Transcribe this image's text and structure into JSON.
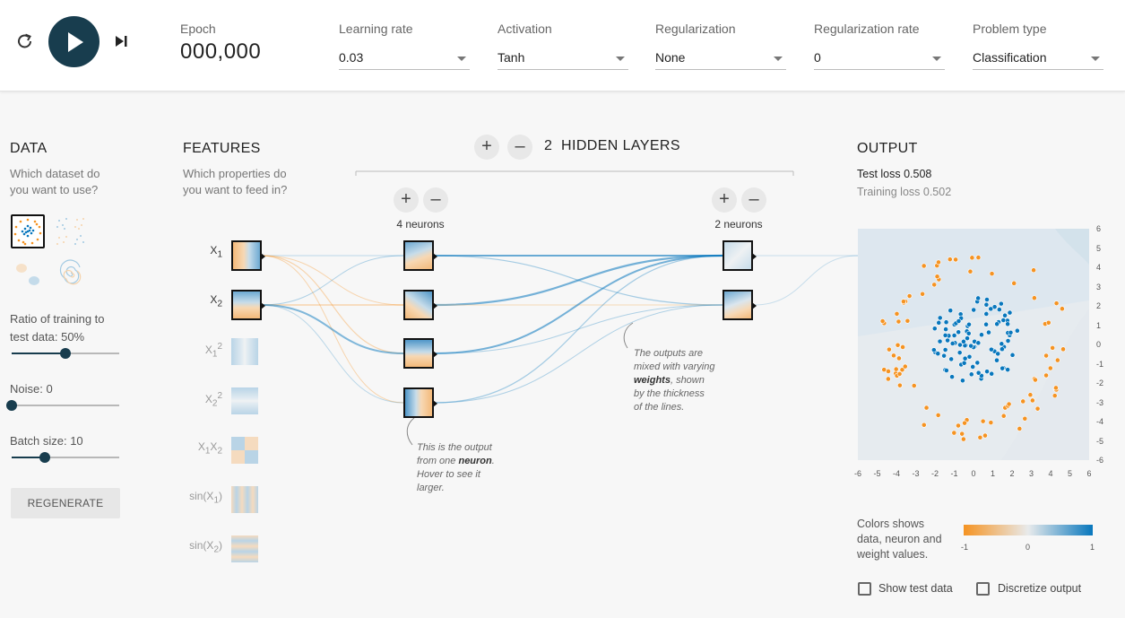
{
  "header": {
    "epoch_label": "Epoch",
    "epoch_value": "000,000",
    "controls": [
      {
        "label": "Learning rate",
        "value": "0.03"
      },
      {
        "label": "Activation",
        "value": "Tanh"
      },
      {
        "label": "Regularization",
        "value": "None"
      },
      {
        "label": "Regularization rate",
        "value": "0"
      },
      {
        "label": "Problem type",
        "value": "Classification"
      }
    ]
  },
  "data_panel": {
    "title": "DATA",
    "subtitle_1": "Which dataset do",
    "subtitle_2": "you want to use?",
    "ratio_label_1": "Ratio of training to",
    "ratio_label_2": "test data:  50%",
    "ratio_value": 0.5,
    "noise_label": "Noise:  0",
    "noise_value": 0,
    "batch_label": "Batch size:  10",
    "batch_value": 0.31,
    "regenerate": "REGENERATE"
  },
  "features_panel": {
    "title": "FEATURES",
    "subtitle_1": "Which properties do",
    "subtitle_2": "you want to feed in?",
    "features": [
      {
        "base": "X",
        "sub": "1",
        "sup": "",
        "active": true
      },
      {
        "base": "X",
        "sub": "2",
        "sup": "",
        "active": true
      },
      {
        "base": "X",
        "sub": "1",
        "sup": "2",
        "active": false
      },
      {
        "base": "X",
        "sub": "2",
        "sup": "2",
        "active": false
      },
      {
        "base": "X",
        "sub": "1",
        "sup": "",
        "base2": "X",
        "sub2": "2",
        "active": false
      },
      {
        "base": "sin(X",
        "sub": "1",
        "tail": ")",
        "active": false
      },
      {
        "base": "sin(X",
        "sub": "2",
        "tail": ")",
        "active": false
      }
    ]
  },
  "network": {
    "layer_count": "2",
    "hidden_label": "HIDDEN LAYERS",
    "add": "+",
    "remove": "–",
    "layer1_label": "4 neurons",
    "layer2_label": "2 neurons",
    "note_neuron_1": "This is the output",
    "note_neuron_2a": "from one ",
    "note_neuron_2b": "neuron",
    "note_neuron_2c": ".",
    "note_neuron_3": "Hover to see it",
    "note_neuron_4": "larger.",
    "note_weights_1": "The outputs are",
    "note_weights_2": "mixed with varying",
    "note_weights_3a": "weights",
    "note_weights_3b": ", shown",
    "note_weights_4": "by the thickness",
    "note_weights_5": "of the lines."
  },
  "output_panel": {
    "title": "OUTPUT",
    "test_loss": "Test loss 0.508",
    "training_loss": "Training loss 0.502",
    "y_ticks": [
      "6",
      "5",
      "4",
      "3",
      "2",
      "1",
      "0",
      "-1",
      "-2",
      "-3",
      "-4",
      "-5",
      "-6"
    ],
    "x_ticks": [
      "-6",
      "-5",
      "-4",
      "-3",
      "-2",
      "-1",
      "0",
      "1",
      "2",
      "3",
      "4",
      "5",
      "6"
    ],
    "legend_1": "Colors shows",
    "legend_2": "data, neuron and",
    "legend_3": "weight values.",
    "cbar_ticks": [
      "-1",
      "0",
      "1"
    ],
    "show_test": "Show test data",
    "discretize": "Discretize output"
  },
  "colors": {
    "positive": "#0877bd",
    "negative": "#f59322",
    "accent": "#183d4e"
  }
}
